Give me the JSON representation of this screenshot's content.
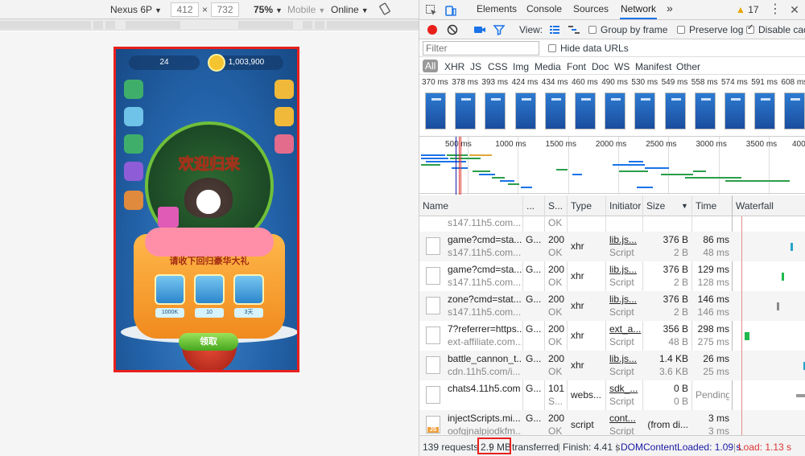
{
  "device_toolbar": {
    "device": "Nexus 6P",
    "width": "412",
    "times": "×",
    "height": "732",
    "zoom": "75%",
    "mode": "Mobile",
    "network": "Online"
  },
  "game": {
    "level": "24",
    "coins": "1,003,900",
    "title": "欢迎归来",
    "banner": "请收下回归豪华大礼",
    "rewards": [
      "1000K",
      "10",
      "3天"
    ],
    "claim": "领取"
  },
  "devtools": {
    "tabs": [
      "Elements",
      "Console",
      "Sources",
      "Network"
    ],
    "more_tabs": "»",
    "warnings": "17",
    "toolbar": {
      "view_label": "View:",
      "group_by_frame": "Group by frame",
      "preserve_log": "Preserve log",
      "disable_cache": "Disable cac"
    },
    "filter": {
      "placeholder": "Filter",
      "hide_data_urls": "Hide data URLs",
      "types": [
        "All",
        "XHR",
        "JS",
        "CSS",
        "Img",
        "Media",
        "Font",
        "Doc",
        "WS",
        "Manifest",
        "Other"
      ]
    },
    "filmstrip_times": [
      "370 ms",
      "378 ms",
      "393 ms",
      "424 ms",
      "434 ms",
      "460 ms",
      "490 ms",
      "530 ms",
      "549 ms",
      "558 ms",
      "574 ms",
      "591 ms",
      "608 ms"
    ],
    "overview_ticks": [
      "500 ms",
      "1000 ms",
      "1500 ms",
      "2000 ms",
      "2500 ms",
      "3000 ms",
      "3500 ms",
      "400"
    ],
    "columns": [
      "Name",
      "...",
      "S...",
      "Type",
      "Initiator",
      "Size",
      "Time",
      "Waterfall"
    ],
    "requests": [
      {
        "name": "s147.11h5.com...",
        "domain": "",
        "method": "",
        "status": "OK",
        "status_text": "",
        "type": "",
        "initiator": "Script",
        "initiator_sub": "",
        "size": "2 B",
        "size_sub": "",
        "time": "49 ms",
        "time_sub": "",
        "partial": true
      },
      {
        "name": "game?cmd=sta...",
        "domain": "s147.11h5.com...",
        "method": "G...",
        "status": "200",
        "status_text": "OK",
        "type": "xhr",
        "initiator": "lib.js...",
        "initiator_sub": "Script",
        "size": "376 B",
        "size_sub": "2 B",
        "time": "86 ms",
        "time_sub": "48 ms"
      },
      {
        "name": "game?cmd=sta...",
        "domain": "s147.11h5.com...",
        "method": "G...",
        "status": "200",
        "status_text": "OK",
        "type": "xhr",
        "initiator": "lib.js...",
        "initiator_sub": "Script",
        "size": "376 B",
        "size_sub": "2 B",
        "time": "129 ms",
        "time_sub": "128 ms"
      },
      {
        "name": "zone?cmd=stat...",
        "domain": "s147.11h5.com...",
        "method": "G...",
        "status": "200",
        "status_text": "OK",
        "type": "xhr",
        "initiator": "lib.js...",
        "initiator_sub": "Script",
        "size": "376 B",
        "size_sub": "2 B",
        "time": "146 ms",
        "time_sub": "146 ms"
      },
      {
        "name": "7?referrer=https...",
        "domain": "ext-affiliate.com...",
        "method": "G...",
        "status": "200",
        "status_text": "OK",
        "type": "xhr",
        "initiator": "ext_a...",
        "initiator_sub": "Script",
        "size": "356 B",
        "size_sub": "48 B",
        "time": "298 ms",
        "time_sub": "275 ms"
      },
      {
        "name": "battle_cannon_t...",
        "domain": "cdn.11h5.com/i...",
        "method": "G...",
        "status": "200",
        "status_text": "OK",
        "type": "xhr",
        "initiator": "lib.js...",
        "initiator_sub": "Script",
        "size": "1.4 KB",
        "size_sub": "3.6 KB",
        "time": "26 ms",
        "time_sub": "25 ms"
      },
      {
        "name": "chats4.11h5.com",
        "domain": "",
        "method": "G...",
        "status": "101",
        "status_text": "S...",
        "type": "webs...",
        "initiator": "sdk_...",
        "initiator_sub": "Script",
        "size": "0 B",
        "size_sub": "0 B",
        "time": "Pending",
        "time_sub": ""
      },
      {
        "name": "injectScripts.mi...",
        "domain": "oofgjnalpjodkfm...",
        "method": "G...",
        "status": "200",
        "status_text": "OK",
        "type": "script",
        "initiator": "cont...",
        "initiator_sub": "Script",
        "size": "(from di...",
        "size_sub": "",
        "time": "3 ms",
        "time_sub": "3 ms"
      }
    ],
    "status_bar": {
      "requests": "139 requests",
      "sep1": "|",
      "transferred_size": "2.9 MB",
      "transferred_label": "transferred",
      "sep2": "|",
      "finish": "Finish: 4.41 s",
      "sep3": "|",
      "dom_content_loaded": "DOMContentLoaded: 1.09 s",
      "sep4": "|",
      "load": "Load: 1.13 s"
    }
  },
  "colors": {
    "highlight_red": "#e8201c",
    "accent_blue": "#1a73e8",
    "dcl_blue": "#1a1aa6",
    "load_red": "#d33"
  }
}
